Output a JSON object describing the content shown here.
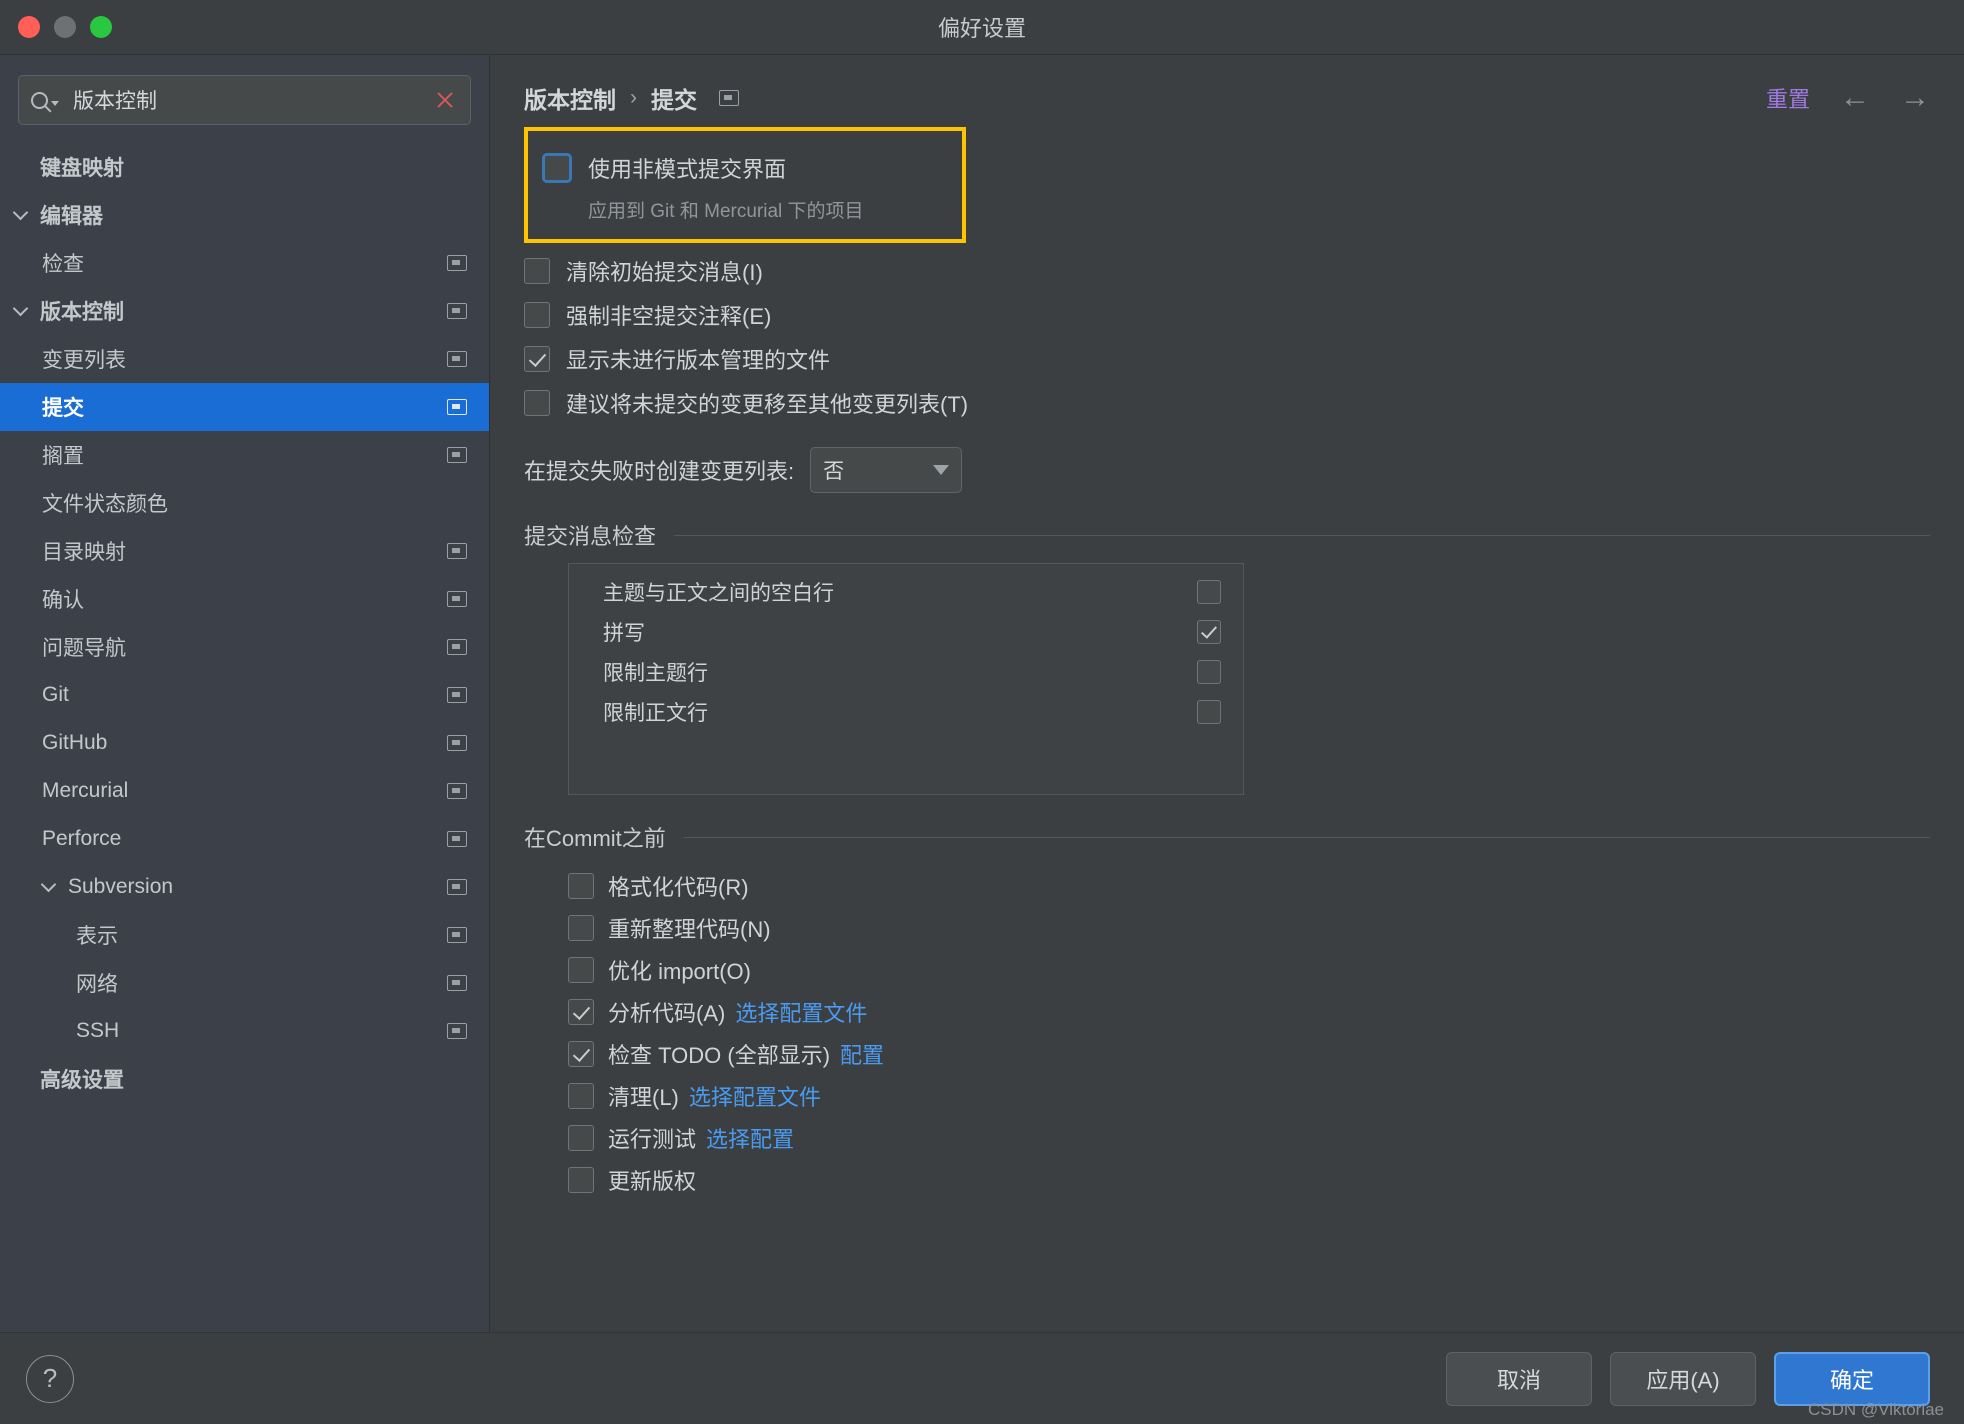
{
  "window": {
    "title": "偏好设置",
    "traffic_lights": [
      "close-red",
      "minimize-yellow",
      "zoom-green"
    ]
  },
  "search": {
    "value": "版本控制",
    "placeholder": "",
    "icon": "search-icon",
    "clear_icon": "clear-x-icon"
  },
  "sidebar": {
    "items": [
      {
        "label": "键盘映射",
        "level": 1,
        "bold": true,
        "arrow": false,
        "badge": false,
        "selected": false
      },
      {
        "label": "编辑器",
        "level": 1,
        "bold": true,
        "arrow": true,
        "badge": false,
        "selected": false
      },
      {
        "label": "检查",
        "level": 2,
        "bold": false,
        "arrow": false,
        "badge": true,
        "selected": false
      },
      {
        "label": "版本控制",
        "level": 1,
        "bold": true,
        "arrow": true,
        "badge": true,
        "selected": false
      },
      {
        "label": "变更列表",
        "level": 2,
        "bold": false,
        "arrow": false,
        "badge": true,
        "selected": false
      },
      {
        "label": "提交",
        "level": 2,
        "bold": true,
        "arrow": false,
        "badge": true,
        "selected": true
      },
      {
        "label": "搁置",
        "level": 2,
        "bold": false,
        "arrow": false,
        "badge": true,
        "selected": false
      },
      {
        "label": "文件状态颜色",
        "level": 2,
        "bold": false,
        "arrow": false,
        "badge": false,
        "selected": false
      },
      {
        "label": "目录映射",
        "level": 2,
        "bold": false,
        "arrow": false,
        "badge": true,
        "selected": false
      },
      {
        "label": "确认",
        "level": 2,
        "bold": false,
        "arrow": false,
        "badge": true,
        "selected": false
      },
      {
        "label": "问题导航",
        "level": 2,
        "bold": false,
        "arrow": false,
        "badge": true,
        "selected": false
      },
      {
        "label": "Git",
        "level": 2,
        "bold": false,
        "arrow": false,
        "badge": true,
        "selected": false
      },
      {
        "label": "GitHub",
        "level": 2,
        "bold": false,
        "arrow": false,
        "badge": true,
        "selected": false
      },
      {
        "label": "Mercurial",
        "level": 2,
        "bold": false,
        "arrow": false,
        "badge": true,
        "selected": false
      },
      {
        "label": "Perforce",
        "level": 2,
        "bold": false,
        "arrow": false,
        "badge": true,
        "selected": false
      },
      {
        "label": "Subversion",
        "level": 2,
        "bold": false,
        "arrow": true,
        "badge": true,
        "selected": false
      },
      {
        "label": "表示",
        "level": 3,
        "bold": false,
        "arrow": false,
        "badge": true,
        "selected": false
      },
      {
        "label": "网络",
        "level": 3,
        "bold": false,
        "arrow": false,
        "badge": true,
        "selected": false
      },
      {
        "label": "SSH",
        "level": 3,
        "bold": false,
        "arrow": false,
        "badge": true,
        "selected": false
      },
      {
        "label": "高级设置",
        "level": 1,
        "bold": true,
        "arrow": false,
        "badge": false,
        "selected": false
      }
    ]
  },
  "header": {
    "breadcrumb_root": "版本控制",
    "breadcrumb_sep": "›",
    "breadcrumb_leaf": "提交",
    "reset_label": "重置",
    "back_icon": "arrow-left-icon",
    "forward_icon": "arrow-right-icon",
    "reset_color": "#9f7ae0"
  },
  "main": {
    "highlight": {
      "label": "使用非模式提交界面",
      "note": "应用到 Git 和 Mercurial 下的项目",
      "checked": false,
      "border_color": "#ffc400"
    },
    "options": [
      {
        "label": "清除初始提交消息(I)",
        "checked": false
      },
      {
        "label": "强制非空提交注释(E)",
        "checked": false
      },
      {
        "label": "显示未进行版本管理的文件",
        "checked": true
      },
      {
        "label": "建议将未提交的变更移至其他变更列表(T)",
        "checked": false
      }
    ],
    "combo": {
      "label": "在提交失败时创建变更列表:",
      "value": "否",
      "caret_icon": "chevron-down-icon"
    },
    "message_check": {
      "title": "提交消息检查",
      "rows": [
        {
          "label": "主题与正文之间的空白行",
          "checked": false
        },
        {
          "label": "拼写",
          "checked": true
        },
        {
          "label": "限制主题行",
          "checked": false
        },
        {
          "label": "限制正文行",
          "checked": false
        }
      ]
    },
    "before_commit": {
      "title": "在Commit之前",
      "rows": [
        {
          "label": "格式化代码(R)",
          "checked": false,
          "link": ""
        },
        {
          "label": "重新整理代码(N)",
          "checked": false,
          "link": ""
        },
        {
          "label": "优化 import(O)",
          "checked": false,
          "link": ""
        },
        {
          "label": "分析代码(A)",
          "checked": true,
          "link": "选择配置文件"
        },
        {
          "label": "检查 TODO (全部显示)",
          "checked": true,
          "link": "配置"
        },
        {
          "label": "清理(L)",
          "checked": false,
          "link": "选择配置文件"
        },
        {
          "label": "运行测试",
          "checked": false,
          "link": "选择配置"
        },
        {
          "label": "更新版权",
          "checked": false,
          "link": ""
        }
      ],
      "link_color": "#4a9bf0"
    }
  },
  "footer": {
    "help_label": "?",
    "cancel_label": "取消",
    "apply_label": "应用(A)",
    "ok_label": "确定",
    "primary_color": "#2f77d0",
    "watermark": "CSDN @Viktoriae"
  }
}
